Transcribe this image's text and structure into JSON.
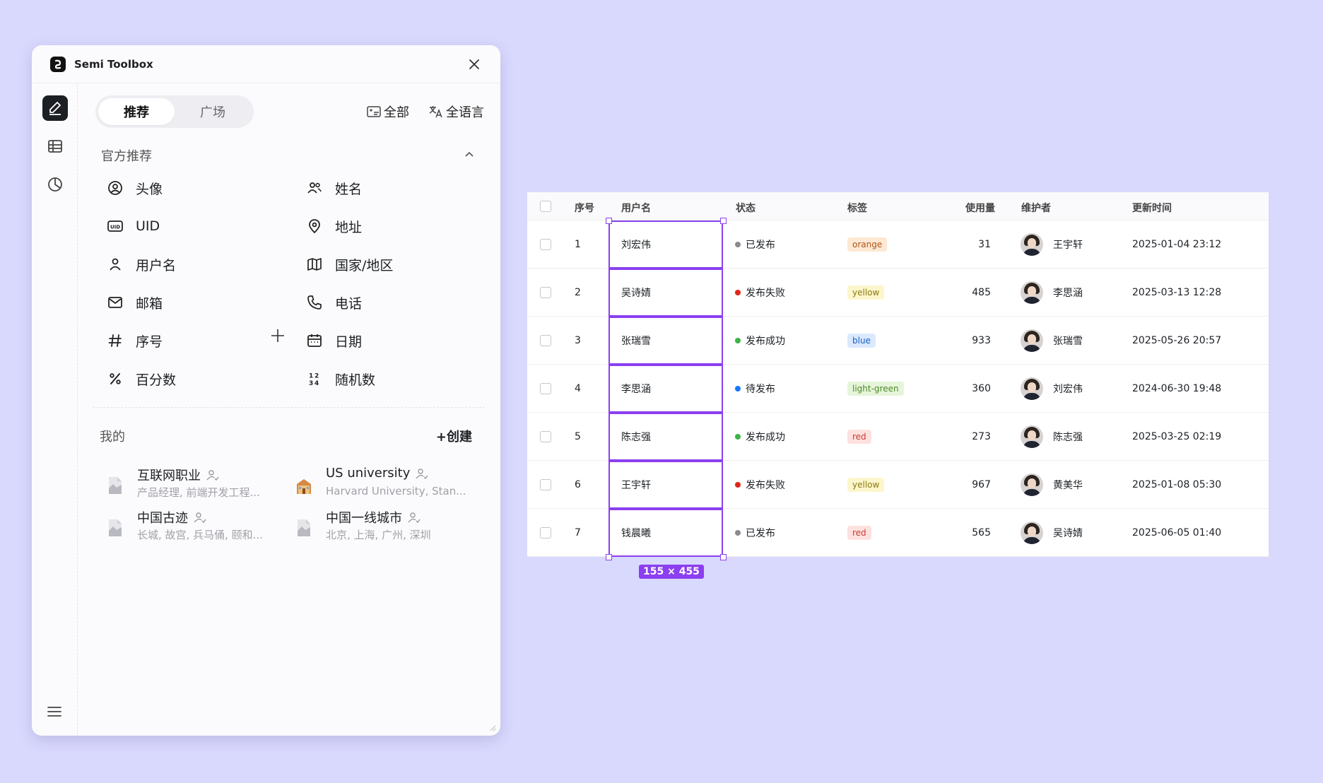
{
  "app": {
    "title": "Semi Toolbox"
  },
  "tabs": [
    {
      "label": "推荐"
    },
    {
      "label": "广场"
    }
  ],
  "top_actions": {
    "all": "全部",
    "all_lang": "全语言"
  },
  "official": {
    "heading": "官方推荐",
    "items": [
      {
        "label": "头像",
        "icon": "avatar-icon"
      },
      {
        "label": "姓名",
        "icon": "people-icon"
      },
      {
        "label": "UID",
        "icon": "uid-icon"
      },
      {
        "label": "地址",
        "icon": "location-icon"
      },
      {
        "label": "用户名",
        "icon": "user-icon"
      },
      {
        "label": "国家/地区",
        "icon": "map-icon"
      },
      {
        "label": "邮箱",
        "icon": "mail-icon"
      },
      {
        "label": "电话",
        "icon": "phone-icon"
      },
      {
        "label": "序号",
        "icon": "hash-icon"
      },
      {
        "label": "日期",
        "icon": "calendar-icon"
      },
      {
        "label": "百分数",
        "icon": "percent-icon"
      },
      {
        "label": "随机数",
        "icon": "random-number-icon"
      }
    ]
  },
  "mine": {
    "heading": "我的",
    "create": "创建",
    "items": [
      {
        "title": "互联网职业",
        "desc": "产品经理, 前端开发工程..."
      },
      {
        "title": "US university",
        "desc": "Harvard University, Stan..."
      },
      {
        "title": "中国古迹",
        "desc": "长城, 故宫, 兵马俑, 颐和..."
      },
      {
        "title": "中国一线城市",
        "desc": "北京, 上海, 广州, 深圳"
      }
    ]
  },
  "table": {
    "headers": {
      "index": "序号",
      "username": "用户名",
      "status": "状态",
      "tag": "标签",
      "usage": "使用量",
      "maintainer": "维护者",
      "updated": "更新时间"
    },
    "rows": [
      {
        "index": "1",
        "username": "刘宏伟",
        "status": "已发布",
        "status_color": "#8a8a8f",
        "tag": "orange",
        "usage": "31",
        "maintainer": "王宇轩",
        "updated": "2025-01-04 23:12"
      },
      {
        "index": "2",
        "username": "吴诗婧",
        "status": "发布失败",
        "status_color": "#e0261b",
        "tag": "yellow",
        "usage": "485",
        "maintainer": "李思涵",
        "updated": "2025-03-13 12:28"
      },
      {
        "index": "3",
        "username": "张瑞雪",
        "status": "发布成功",
        "status_color": "#3bb346",
        "tag": "blue",
        "usage": "933",
        "maintainer": "张瑞雪",
        "updated": "2025-05-26 20:57"
      },
      {
        "index": "4",
        "username": "李思涵",
        "status": "待发布",
        "status_color": "#1677ff",
        "tag": "light-green",
        "usage": "360",
        "maintainer": "刘宏伟",
        "updated": "2024-06-30 19:48"
      },
      {
        "index": "5",
        "username": "陈志强",
        "status": "发布成功",
        "status_color": "#3bb346",
        "tag": "red",
        "usage": "273",
        "maintainer": "陈志强",
        "updated": "2025-03-25 02:19"
      },
      {
        "index": "6",
        "username": "王宇轩",
        "status": "发布失败",
        "status_color": "#e0261b",
        "tag": "yellow",
        "usage": "967",
        "maintainer": "黄美华",
        "updated": "2025-01-08 05:30"
      },
      {
        "index": "7",
        "username": "钱晨曦",
        "status": "已发布",
        "status_color": "#8a8a8f",
        "tag": "red",
        "usage": "565",
        "maintainer": "吴诗婧",
        "updated": "2025-06-05 01:40"
      }
    ]
  },
  "selection": {
    "size_label": "155 × 455",
    "color": "#8b3ff0"
  },
  "tag_colors": {
    "orange": {
      "bg": "#fde8d3",
      "fg": "#b1541a"
    },
    "yellow": {
      "bg": "#fdf6cc",
      "fg": "#8a7a10"
    },
    "blue": {
      "bg": "#dbe9fe",
      "fg": "#1b5fc4"
    },
    "light-green": {
      "bg": "#e6f5d9",
      "fg": "#4d8a2a"
    },
    "red": {
      "bg": "#fde1df",
      "fg": "#c93a30"
    }
  }
}
